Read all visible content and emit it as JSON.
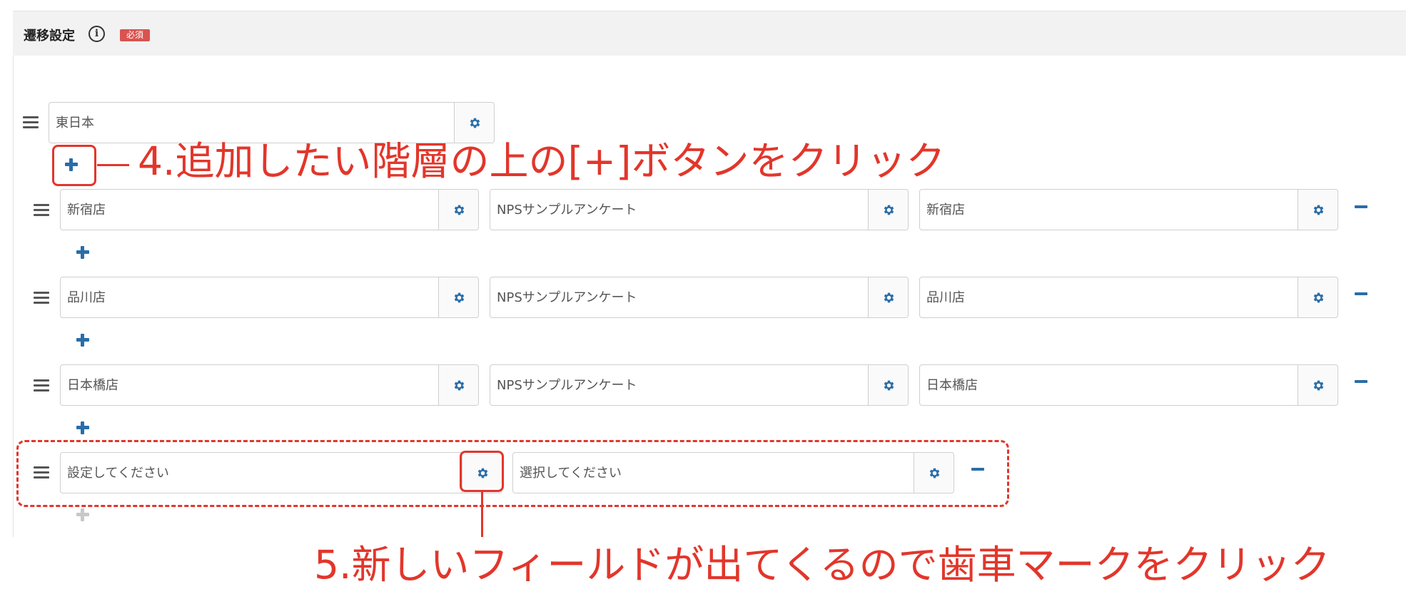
{
  "section": {
    "title": "遷移設定",
    "info_icon": "info-circle-icon",
    "required_badge": "必須",
    "badge_color": "#d9534f"
  },
  "accent_color": "#2a6da8",
  "annotation_color": "#e2362b",
  "root_row": {
    "field": "東日本"
  },
  "rows": [
    {
      "fields": [
        "新宿店",
        "NPSサンプルアンケート",
        "新宿店"
      ]
    },
    {
      "fields": [
        "品川店",
        "NPSサンプルアンケート",
        "品川店"
      ]
    },
    {
      "fields": [
        "日本橋店",
        "NPSサンプルアンケート",
        "日本橋店"
      ]
    },
    {
      "fields": [
        "設定してください",
        "選択してください"
      ]
    }
  ],
  "annotations": {
    "step4": "4.追加したい階層の上の[+]ボタンをクリック",
    "step5": "5.新しいフィールドが出てくるので歯車マークをクリック"
  }
}
